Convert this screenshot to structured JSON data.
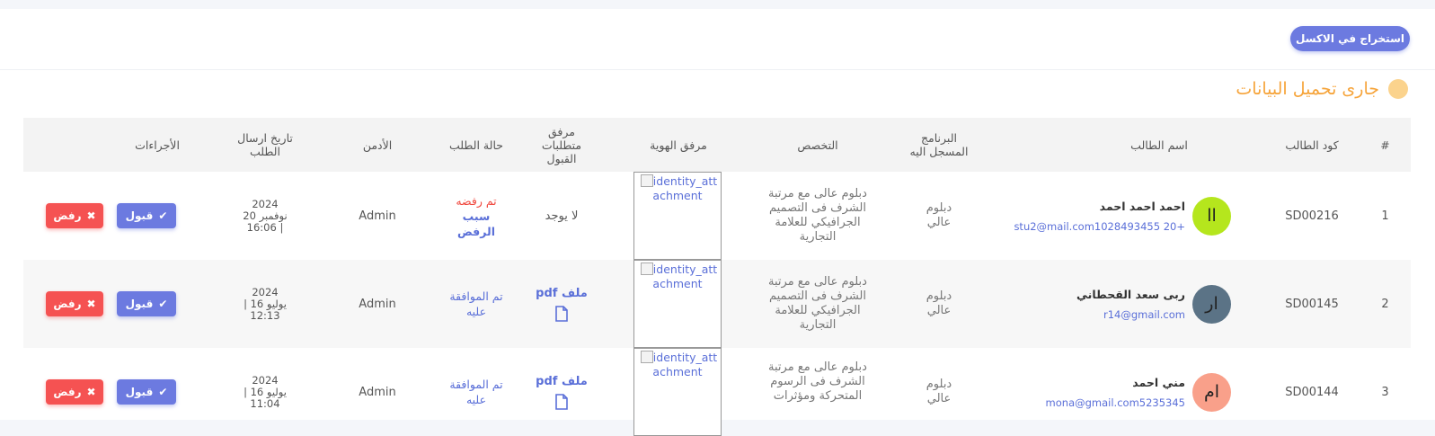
{
  "toolbar": {
    "export_label": "استخراج في الاكسل"
  },
  "loading": {
    "text": "جارى تحميل البيانات"
  },
  "table": {
    "headers": {
      "index": "#",
      "code": "كود الطالب",
      "name": "اسم الطالب",
      "program": "البرنامج المسجل اليه",
      "specialization": "التخصص",
      "id_attachment": "مرفق الهوية",
      "requirements": "مرفق متطلبات القبول",
      "status": "حالة الطلب",
      "admin": "الأدمن",
      "date": "تاريخ ارسال الطلب",
      "actions": "الأجراءات"
    },
    "rows": [
      {
        "index": "1",
        "code": "SD00216",
        "avatar": "اا",
        "avatar_color": "#b5e61d",
        "name": "احمد احمد احمد",
        "email": "stu2@mail.com1028493455 20+",
        "program": "دبلوم عالي",
        "specialization": "دبلوم عالى مع مرتبة الشرف فى التصميم الجرافيكي للعلامة التجارية",
        "id_attachment": "identity_attachment",
        "requirements": "لا يوجد",
        "status_line1": "تم رفضه",
        "status_line2": "سبب الرفض",
        "admin": "Admin",
        "date_year": "2024",
        "date_line2": "نوفمبر 20",
        "date_line3": "| 16:06",
        "accept": "قبول",
        "reject": "رفض"
      },
      {
        "index": "2",
        "code": "SD00145",
        "avatar": "ار",
        "avatar_color": "#5b7386",
        "name": "ربى سعد القحطاني",
        "email": "r14@gmail.com",
        "program": "دبلوم عالي",
        "specialization": "دبلوم عالى مع مرتبة الشرف فى التصميم الجرافيكي للعلامة التجارية",
        "id_attachment": "identity_attachment",
        "requirements": "ملف pdf",
        "status": "تم الموافقة عليه",
        "admin": "Admin",
        "date_year": "2024",
        "date_line2": "يوليو 16 |",
        "date_line3": "12:13",
        "accept": "قبول",
        "reject": "رفض"
      },
      {
        "index": "3",
        "code": "SD00144",
        "avatar": "ام",
        "avatar_color": "#f9a08a",
        "name": "مني احمد",
        "email": "mona@gmail.com5235345",
        "program": "دبلوم عالي",
        "specialization": "دبلوم عالى مع مرتبة الشرف فى الرسوم المتحركة ومؤثرات",
        "id_attachment": "identity_attachment",
        "requirements": "ملف pdf",
        "status": "تم الموافقة عليه",
        "admin": "Admin",
        "date_year": "2024",
        "date_line2": "يوليو 16 |",
        "date_line3": "11:04",
        "accept": "قبول",
        "reject": "رفض"
      }
    ]
  },
  "colors": {
    "primary": "#6c7ae0",
    "danger": "#f55252",
    "warning": "#f6a43a",
    "link": "#5a6fd8"
  },
  "icons": {
    "check": "check-icon",
    "close": "close-icon",
    "file": "file-icon",
    "broken_image": "broken-image-icon"
  }
}
